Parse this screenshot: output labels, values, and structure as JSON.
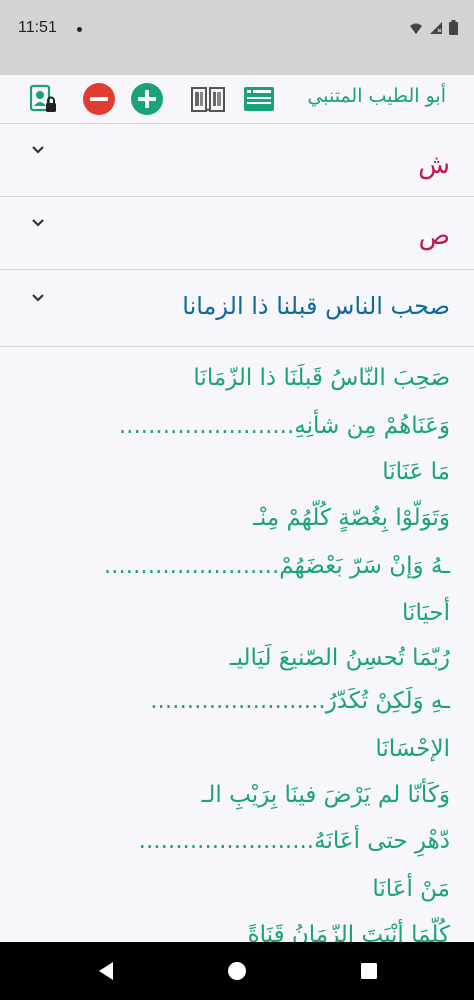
{
  "status": {
    "time": "11:51"
  },
  "toolbar": {
    "app_title": "أبو الطيب المتنبي"
  },
  "sections": [
    {
      "title": "ش"
    },
    {
      "title": "ص"
    },
    {
      "title": "صحب الناس قبلنا ذا الزمانا"
    }
  ],
  "poem": {
    "lines": [
      "صَحِبَ النّاسُ قَبلَنَا ذا الزّمَانَا",
      "وَعَنَاهُمْ مِن شأنِهِ........................",
      "مَا عَنَانَا",
      "وَتَوَلّوْا بِغُصّةٍ كُلّهُمْ مِنْـ",
      "ـهُ وَإنْ سَرّ بَعْضَهُمْ........................",
      "أحيَانَا",
      "رُبّمَا تُحسِنُ الصّنيعَ لَيَاليـ",
      "ـهِ وَلَكِنْ تُكَدّرُ........................",
      "الإحْسَانَا",
      "وَكَأنّا لم يَرْضَ فينَا بِرَيْبِ الـ",
      "دّهْرِ حتى أعَانَهُ........................",
      "مَنْ أعَانَا",
      "كُلّمَا أنْبَتَ الزّمَانُ قَنَاةً"
    ]
  },
  "colors": {
    "accent_green": "#1aa37a",
    "section_red": "#c0185a",
    "section_blue": "#0e6a9c",
    "remove_red": "#e23b32"
  }
}
